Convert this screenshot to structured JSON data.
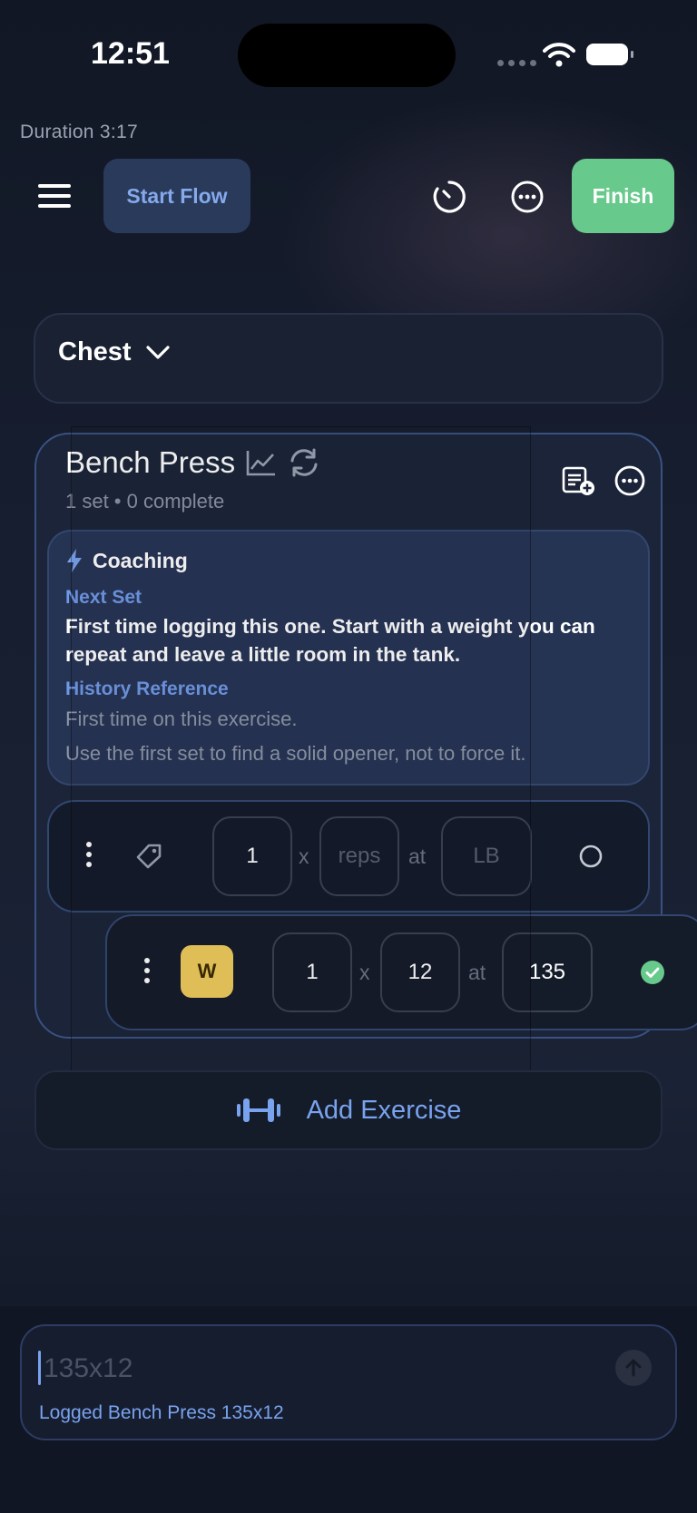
{
  "status_bar": {
    "time": "12:51"
  },
  "header": {
    "duration": "Duration 3:17",
    "start_flow_label": "Start Flow",
    "finish_label": "Finish"
  },
  "group": {
    "label": "Chest"
  },
  "exercise": {
    "title": "Bench Press",
    "subtitle": "1 set • 0 complete",
    "coaching": {
      "title": "Coaching",
      "next_set_label": "Next Set",
      "next_set_text": "First time logging this one. Start with a weight you can repeat and leave a little room in the tank.",
      "history_label": "History Reference",
      "history_text": "First time on this exercise.",
      "history_tip": "Use the first set to find a solid opener, not to force it."
    },
    "sets": [
      {
        "set_number": "1",
        "times": "x",
        "reps_placeholder": "reps",
        "at": "at",
        "weight_placeholder": "LB",
        "done": false
      },
      {
        "badge": "W",
        "set_number": "1",
        "times": "x",
        "reps": "12",
        "at": "at",
        "weight": "135",
        "done": true
      }
    ]
  },
  "add_exercise_label": "Add Exercise",
  "composer": {
    "placeholder": "135x12",
    "status": "Logged Bench Press 135x12"
  },
  "colors": {
    "accent": "#79a3ee",
    "finish": "#67c98b",
    "warmup_badge": "#f1cd5c",
    "done_check": "#67c98b"
  }
}
